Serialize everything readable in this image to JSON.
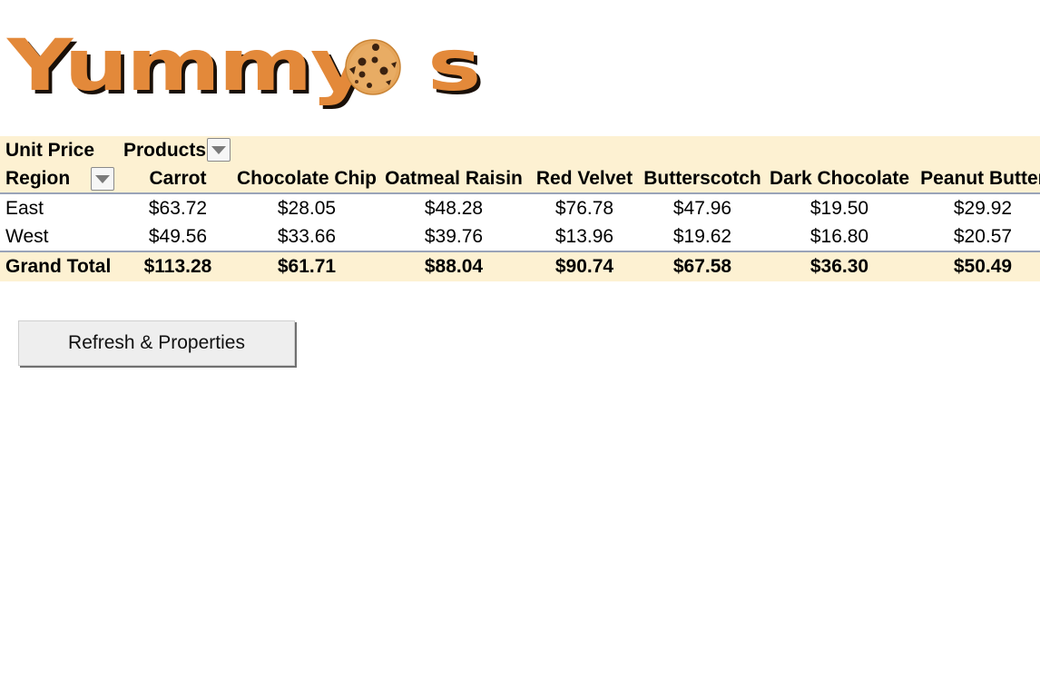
{
  "logo": {
    "text_before": "Yummy",
    "text_after": "s",
    "brand_color": "#e3893a",
    "cookie_icon": "cookie-icon"
  },
  "pivot": {
    "value_field_label": "Unit Price",
    "column_field_label": "Products",
    "row_field_label": "Region",
    "header_background": "#fdf1d2",
    "columns": [
      "Carrot",
      "Chocolate Chip",
      "Oatmeal Raisin",
      "Red Velvet",
      "Butterscotch",
      "Dark Chocolate",
      "Peanut Butter"
    ],
    "rows": [
      {
        "label": "East",
        "values": [
          "$63.72",
          "$28.05",
          "$48.28",
          "$76.78",
          "$47.96",
          "$19.50",
          "$29.92"
        ]
      },
      {
        "label": "West",
        "values": [
          "$49.56",
          "$33.66",
          "$39.76",
          "$13.96",
          "$19.62",
          "$16.80",
          "$20.57"
        ]
      }
    ],
    "grand_total": {
      "label": "Grand Total",
      "values": [
        "$113.28",
        "$61.71",
        "$88.04",
        "$90.74",
        "$67.58",
        "$36.30",
        "$50.49"
      ]
    }
  },
  "buttons": {
    "refresh_label": "Refresh & Properties"
  }
}
